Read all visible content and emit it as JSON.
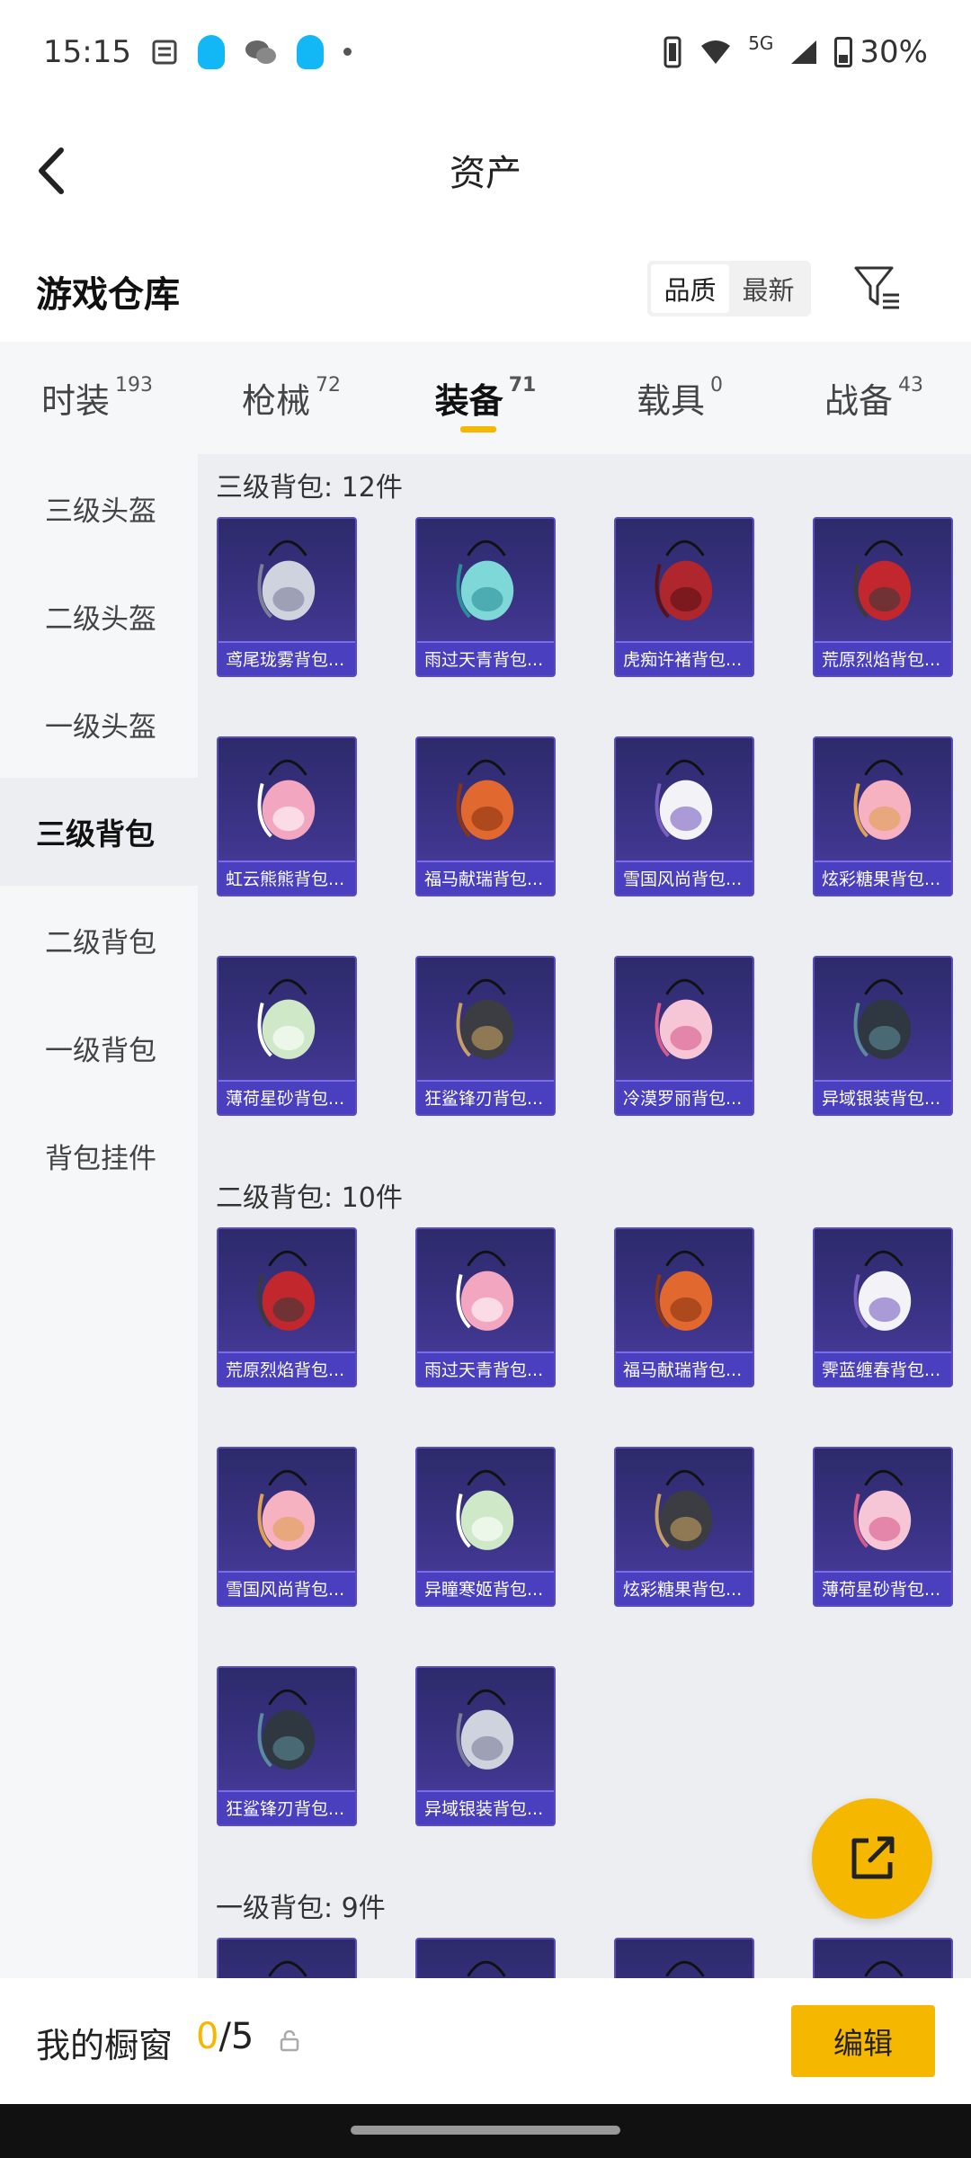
{
  "status_bar": {
    "time": "15:15",
    "network": "5G",
    "battery": "30%"
  },
  "header": {
    "title": "资产"
  },
  "warehouse": {
    "title": "游戏仓库",
    "sort_options": [
      "品质",
      "最新"
    ],
    "active_sort": "品质"
  },
  "tabs": [
    {
      "label": "时装",
      "count": "193"
    },
    {
      "label": "枪械",
      "count": "72"
    },
    {
      "label": "装备",
      "count": "71",
      "active": true
    },
    {
      "label": "载具",
      "count": "0"
    },
    {
      "label": "战备",
      "count": "43"
    }
  ],
  "sidebar": {
    "items": [
      "三级头盔",
      "二级头盔",
      "一级头盔",
      "三级背包",
      "二级背包",
      "一级背包",
      "背包挂件"
    ],
    "active": "三级背包"
  },
  "sections": [
    {
      "title": "三级背包: 12件",
      "items": [
        "鸢尾珑雾背包...",
        "雨过天青背包...",
        "虎痴许褚背包...",
        "荒原烈焰背包...",
        "虹云熊熊背包...",
        "福马献瑞背包...",
        "雪国风尚背包...",
        "炫彩糖果背包...",
        "薄荷星砂背包...",
        "狂鲨锋刃背包...",
        "冷漠罗丽背包...",
        "异域银装背包..."
      ]
    },
    {
      "title": "二级背包: 10件",
      "items": [
        "荒原烈焰背包...",
        "雨过天青背包...",
        "福马献瑞背包...",
        "霁蓝缠春背包...",
        "雪国风尚背包...",
        "异瞳寒姬背包...",
        "炫彩糖果背包...",
        "薄荷星砂背包...",
        "狂鲨锋刃背包...",
        "异域银装背包..."
      ]
    },
    {
      "title": "一级背包: 9件",
      "items": [
        "",
        "",
        "",
        ""
      ]
    }
  ],
  "bottom": {
    "label": "我的橱窗",
    "current": "0",
    "total": "/5",
    "edit_label": "编辑"
  },
  "colors": {
    "accent": "#f5b700",
    "card_label": "#4a3fbf"
  }
}
